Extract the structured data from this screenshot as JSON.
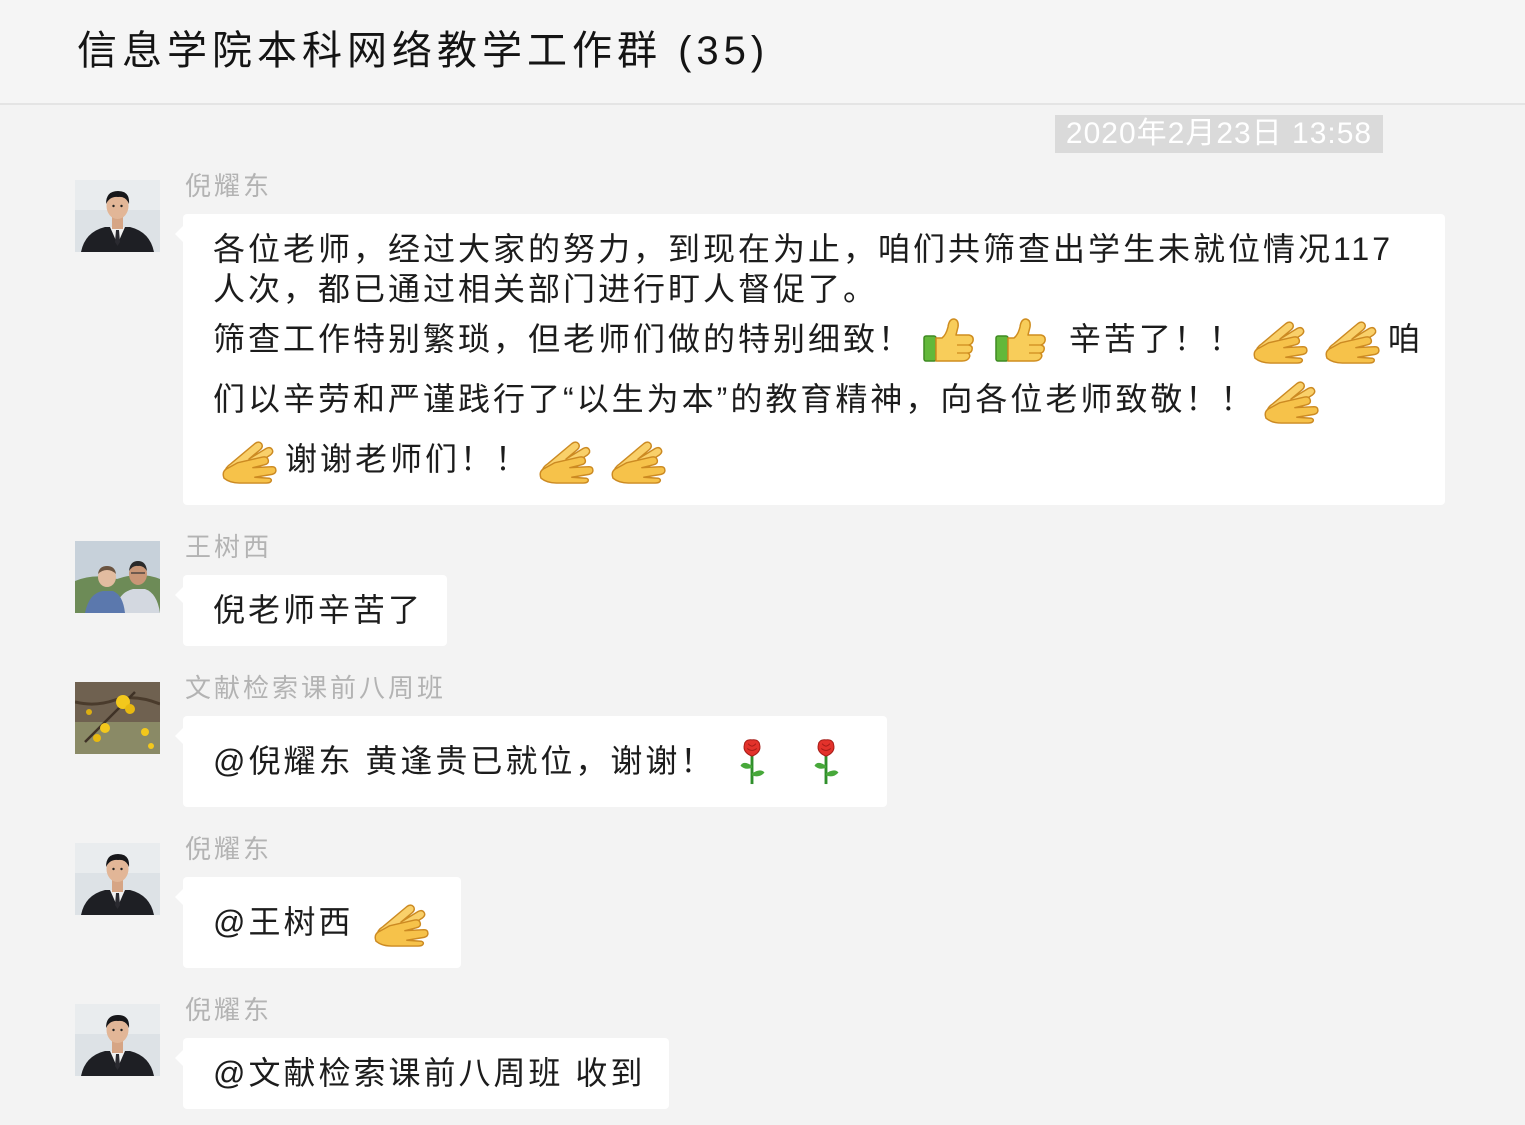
{
  "header": {
    "title": "信息学院本科网络教学工作群 (35)"
  },
  "timestamp": "2020年2月23日 13:58",
  "colors": {
    "background": "#f3f3f3",
    "header_background": "#f5f5f5",
    "bubble": "#ffffff",
    "timestamp_background": "#dadada",
    "sender_name": "#b3b3b3",
    "text": "#1c1c1c"
  },
  "messages": [
    {
      "sender": "倪耀东",
      "avatar": "suit-portrait-avatar",
      "lines": [
        [
          {
            "text": "各位老师，经过大家的努力，到现在为止，咱们共筛查出学生未就位情况117"
          }
        ],
        [
          {
            "text": "人次，都已通过相关部门进行盯人督促了。"
          }
        ],
        [
          {
            "text": "筛查工作特别繁琐，但老师们做的特别细致！"
          },
          {
            "icon": "thumbs-up-icon"
          },
          {
            "icon": "thumbs-up-icon"
          },
          {
            "text": " 辛苦了！！"
          },
          {
            "icon": "clap-icon"
          },
          {
            "icon": "clap-icon"
          },
          {
            "text": "咱"
          }
        ],
        [
          {
            "text": "们以辛劳和严谨践行了“以生为本”的教育精神，向各位老师致敬！！"
          },
          {
            "icon": "clap-icon"
          }
        ],
        [
          {
            "icon": "clap-icon"
          },
          {
            "text": "谢谢老师们！！"
          },
          {
            "icon": "clap-icon"
          },
          {
            "icon": "clap-icon"
          }
        ]
      ]
    },
    {
      "sender": "王树西",
      "avatar": "parent-child-avatar",
      "lines": [
        [
          {
            "text": "倪老师辛苦了"
          }
        ]
      ]
    },
    {
      "sender": "文献检索课前八周班",
      "avatar": "yellow-flower-avatar",
      "lines": [
        [
          {
            "text": "@倪耀东 黄逢贵已就位，谢谢！"
          },
          {
            "icon": "rose-icon"
          },
          {
            "icon": "rose-icon"
          }
        ]
      ]
    },
    {
      "sender": "倪耀东",
      "avatar": "suit-portrait-avatar",
      "lines": [
        [
          {
            "text": "@王树西 "
          },
          {
            "icon": "clap-icon"
          }
        ]
      ]
    },
    {
      "sender": "倪耀东",
      "avatar": "suit-portrait-avatar",
      "lines": [
        [
          {
            "text": "@文献检索课前八周班 收到"
          }
        ]
      ]
    }
  ]
}
